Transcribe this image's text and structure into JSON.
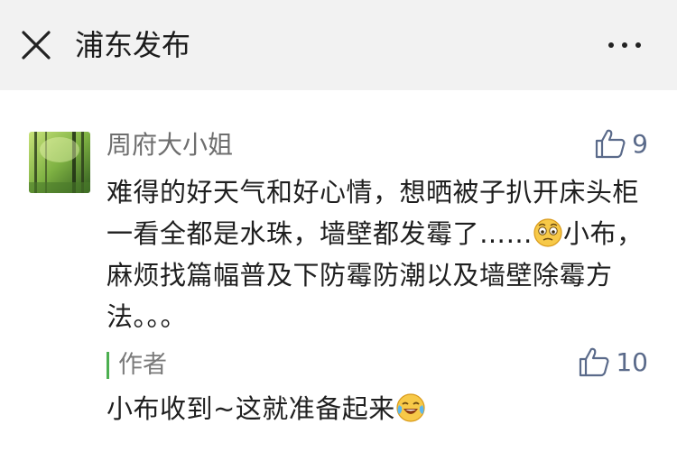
{
  "header": {
    "title": "浦东发布",
    "close_icon": "close-icon",
    "more_icon": "more-icon"
  },
  "comment": {
    "username": "周府大小姐",
    "likes": "9",
    "text_part1": "难得的好天气和好心情，想晒被子扒开床头柜一看全都是水珠，墙壁都发霉了……",
    "emoji_1": "worried-face-emoji",
    "text_part2": "小布，麻烦找篇幅普及下防霉防潮以及墙壁除霉方法。。。"
  },
  "reply": {
    "author_label": "作者",
    "likes": "10",
    "text": "小布收到~这就准备起来",
    "emoji_1": "tears-of-joy-emoji"
  },
  "colors": {
    "header_bg": "#f2f2f2",
    "username": "#6e6e6e",
    "like_color": "#5a6a8a",
    "author_bar": "#4caf50"
  }
}
